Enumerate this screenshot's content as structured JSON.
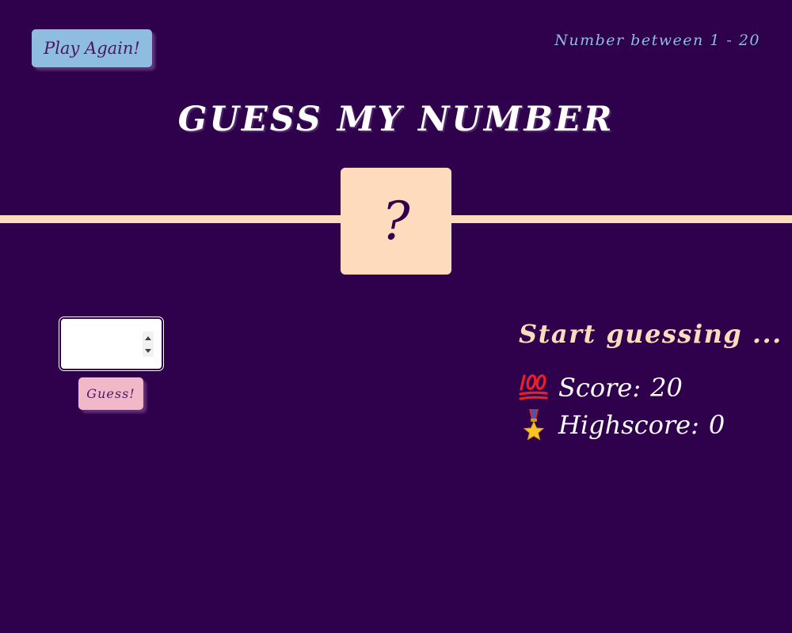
{
  "header": {
    "again_label": "Play Again!",
    "range_hint": "Number between 1 - 20",
    "title": "GUESS MY NUMBER"
  },
  "secret": {
    "display": "?"
  },
  "input": {
    "value": "",
    "placeholder": ""
  },
  "actions": {
    "guess_label": "Guess!"
  },
  "status": {
    "message": "Start guessing ..."
  },
  "stats": {
    "score_icon": "hundred-points-icon",
    "score_label": "Score:",
    "score_value": "20",
    "highscore_icon": "medal-icon",
    "highscore_label": "Highscore:",
    "highscore_value": "0"
  },
  "colors": {
    "background": "#2f004b",
    "accent_light": "#ffdbbd",
    "again_button": "#8fbde0",
    "guess_button": "#f1b9c8",
    "text": "#ffffff"
  }
}
